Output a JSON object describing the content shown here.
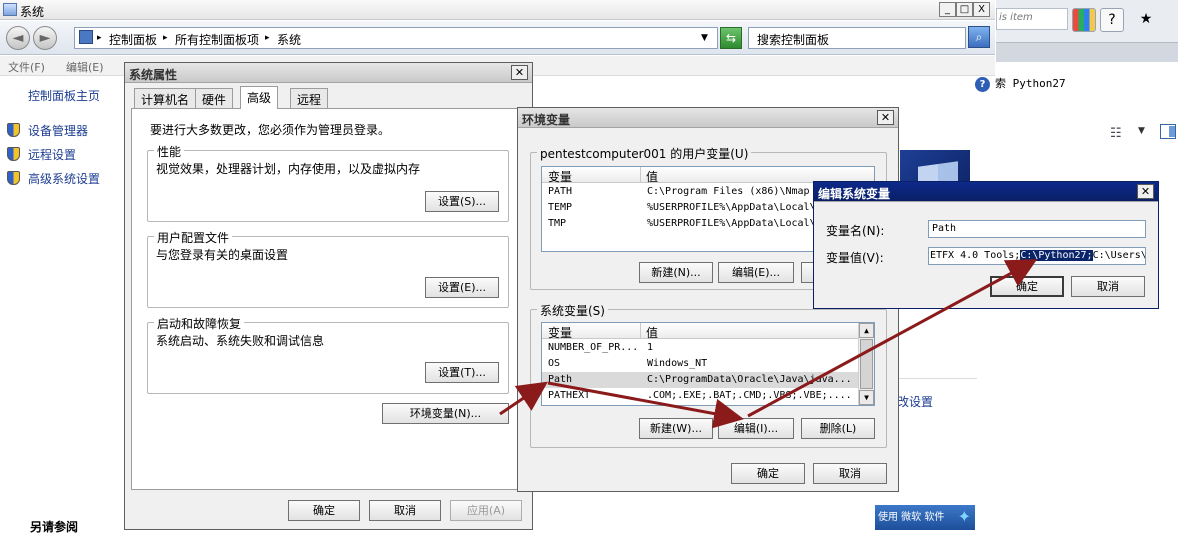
{
  "window": {
    "title": "系统",
    "controls": {
      "minimize": "_",
      "maximize": "□",
      "close": "X"
    }
  },
  "nav": {
    "back": "◄",
    "forward": "►",
    "address_dropdown": "▼",
    "breadcrumb": [
      "控制面板",
      "所有控制面板项",
      "系统"
    ],
    "breadcrumb_sep": "▸",
    "search_placeholder": "搜索控制面板"
  },
  "menu": [
    "文件(F)",
    "编辑(E)"
  ],
  "left_panel": {
    "home": "控制面板主页",
    "links": [
      "设备管理器",
      "远程设置",
      "高级系统设置"
    ],
    "bottom": "另请参阅"
  },
  "right_bg": {
    "search_fragment": "索 Python27",
    "link_fragment": "改设置",
    "badge": "使用 微软 软件"
  },
  "browser": {
    "search_fragment": "is item",
    "help": "?",
    "star": "★"
  },
  "sysprops": {
    "title": "系统属性",
    "tabs": [
      "计算机名",
      "硬件",
      "高级",
      "远程"
    ],
    "notice": "要进行大多数更改，您必须作为管理员登录。",
    "performance": {
      "legend": "性能",
      "desc": "视觉效果，处理器计划，内存使用，以及虚拟内存",
      "button": "设置(S)..."
    },
    "profiles": {
      "legend": "用户配置文件",
      "desc": "与您登录有关的桌面设置",
      "button": "设置(E)..."
    },
    "startup": {
      "legend": "启动和故障恢复",
      "desc": "系统启动、系统失败和调试信息",
      "button": "设置(T)..."
    },
    "env_button": "环境变量(N)...",
    "ok": "确定",
    "cancel": "取消",
    "apply": "应用(A)"
  },
  "envvars": {
    "title": "环境变量",
    "user_legend": "pentestcomputer001 的用户变量(U)",
    "columns": [
      "变量",
      "值"
    ],
    "user_rows": [
      {
        "name": "PATH",
        "value": "C:\\Program Files (x86)\\Nmap"
      },
      {
        "name": "TEMP",
        "value": "%USERPROFILE%\\AppData\\Local\\"
      },
      {
        "name": "TMP",
        "value": "%USERPROFILE%\\AppData\\Local\\"
      }
    ],
    "user_buttons": [
      "新建(N)...",
      "编辑(E)..."
    ],
    "sys_legend": "系统变量(S)",
    "sys_rows": [
      {
        "name": "NUMBER_OF_PR...",
        "value": "1"
      },
      {
        "name": "OS",
        "value": "Windows_NT"
      },
      {
        "name": "Path",
        "value": "C:\\ProgramData\\Oracle\\Java\\java..."
      },
      {
        "name": "PATHEXT",
        "value": ".COM;.EXE;.BAT;.CMD;.VBS;.VBE;...."
      }
    ],
    "sys_buttons": [
      "新建(W)...",
      "编辑(I)...",
      "删除(L)"
    ],
    "ok": "确定",
    "cancel": "取消"
  },
  "editvar": {
    "title": "编辑系统变量",
    "name_label": "变量名(N):",
    "name_value": "Path",
    "value_label": "变量值(V):",
    "value_before": "ETFX 4.0 Tools;",
    "value_selected": "C:\\Python27;",
    "value_after": "C:\\Users\\",
    "ok": "确定",
    "cancel": "取消"
  },
  "colors": {
    "active_title": "#0d2a8a",
    "selection": "#0a246a",
    "arrow": "#8b1a1a"
  }
}
